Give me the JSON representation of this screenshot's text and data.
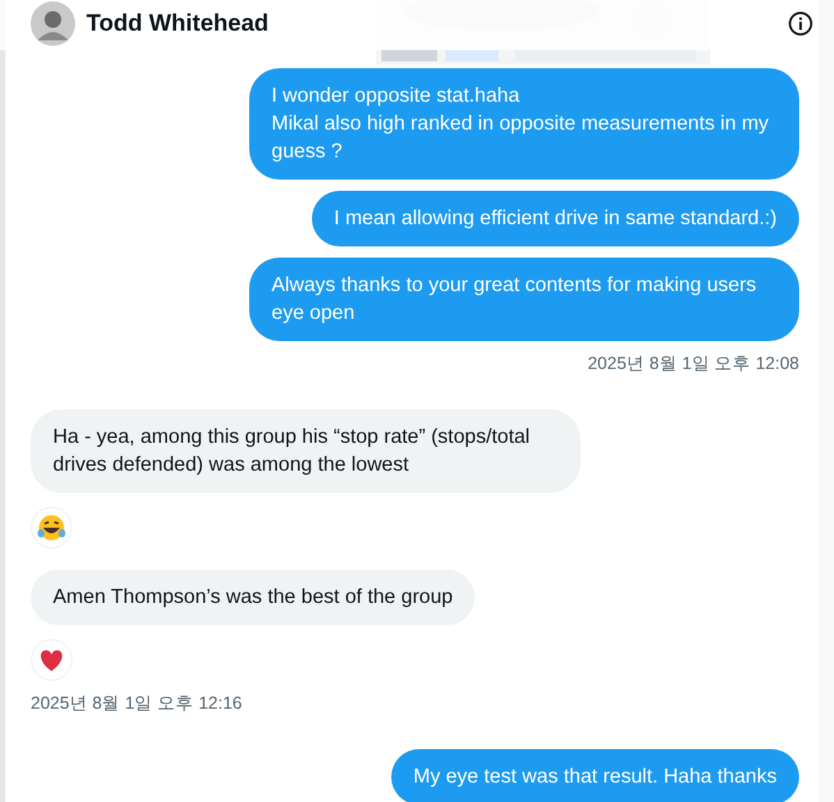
{
  "header": {
    "name": "Todd Whitehead"
  },
  "messages": [
    {
      "kind": "sent",
      "text": "I wonder opposite stat.haha\nMikal also high ranked in opposite measurements in my guess ?"
    },
    {
      "kind": "sent",
      "text": "I mean allowing efficient drive in same standard.:)"
    },
    {
      "kind": "sent",
      "text": "Always thanks to your great contents for making users eye open",
      "time": "2025년 8월 1일 오후 12:08"
    },
    {
      "kind": "received",
      "text": "Ha - yea, among this group his “stop rate” (stops/total drives defended) was among the lowest",
      "reaction": {
        "kind": "laughing"
      }
    },
    {
      "kind": "received",
      "text": "Amen Thompson’s was the best of the group",
      "reaction": {
        "kind": "heart"
      },
      "time": "2025년 8월 1일 오후 12:16"
    },
    {
      "kind": "sent",
      "text": "My eye test was that result. Haha thanks"
    }
  ]
}
